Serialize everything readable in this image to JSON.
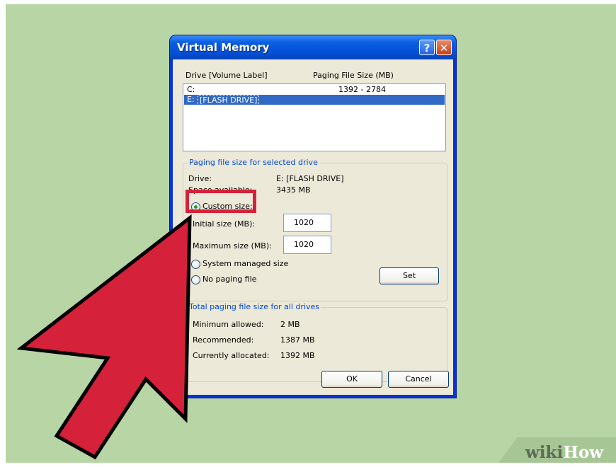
{
  "window": {
    "title": "Virtual Memory",
    "help_glyph": "?",
    "close_glyph": "✕"
  },
  "drive_list": {
    "headers": {
      "drive": "Drive  [Volume Label]",
      "paging": "Paging File Size (MB)"
    },
    "rows": [
      {
        "drive": "C:",
        "label": "",
        "size": "1392 - 2784",
        "selected": false
      },
      {
        "drive": "E:",
        "label": "[FLASH DRIVE]",
        "size": "",
        "selected": true
      }
    ]
  },
  "selected_drive": {
    "group_label": "Paging file size for selected drive",
    "drive_label": "Drive:",
    "drive_value": "E:  [FLASH DRIVE]",
    "space_label": "Space available:",
    "space_value": "3435 MB",
    "options": {
      "custom": "Custom size:",
      "system": "System managed size",
      "none": "No paging file"
    },
    "selected_option": "custom",
    "initial_label": "Initial size (MB):",
    "initial_value": "1020",
    "maximum_label": "Maximum size (MB):",
    "maximum_value": "1020",
    "set_button": "Set"
  },
  "totals": {
    "group_label": "Total paging file size for all drives",
    "min_label": "Minimum allowed:",
    "min_value": "2 MB",
    "rec_label": "Recommended:",
    "rec_value": "1387 MB",
    "cur_label": "Currently allocated:",
    "cur_value": "1392 MB"
  },
  "buttons": {
    "ok": "OK",
    "cancel": "Cancel"
  },
  "overlay": {
    "highlight_color": "#d6213a",
    "arrow_color": "#d6213a"
  },
  "watermark": {
    "part1": "wiki",
    "part2": "How"
  },
  "colors": {
    "background": "#b8d5a5",
    "titlebar": "#0a5fe0",
    "selection": "#316ac5",
    "group_label": "#0046d5"
  }
}
